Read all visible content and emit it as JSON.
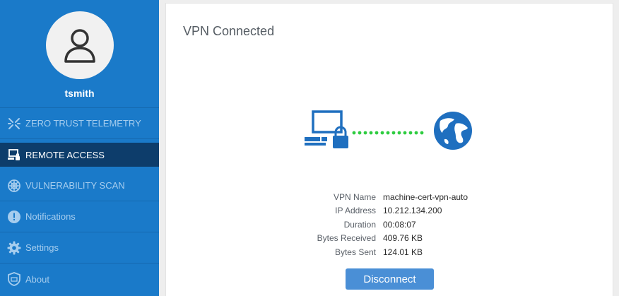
{
  "user": {
    "username": "tsmith"
  },
  "sidebar": {
    "items": [
      {
        "label": "ZERO TRUST TELEMETRY",
        "icon": "telemetry-icon"
      },
      {
        "label": "REMOTE ACCESS",
        "icon": "remote-access-icon",
        "active": true
      },
      {
        "label": "VULNERABILITY SCAN",
        "icon": "vulnerability-scan-icon"
      },
      {
        "label": "Notifications",
        "icon": "notification-icon"
      },
      {
        "label": "Settings",
        "icon": "gear-icon"
      },
      {
        "label": "About",
        "icon": "shield-icon"
      }
    ]
  },
  "main": {
    "title": "VPN Connected",
    "details": [
      {
        "key": "VPN Name",
        "value": "machine-cert-vpn-auto"
      },
      {
        "key": "IP Address",
        "value": "10.212.134.200"
      },
      {
        "key": "Duration",
        "value": "00:08:07"
      },
      {
        "key": "Bytes Received",
        "value": "409.76 KB"
      },
      {
        "key": "Bytes Sent",
        "value": "124.01 KB"
      }
    ],
    "disconnect_label": "Disconnect"
  },
  "colors": {
    "sidebar_bg": "#1a7ac9",
    "active_bg": "#0d3d6b",
    "accent": "#4a8fd6",
    "connection_dots": "#2ecc40"
  }
}
